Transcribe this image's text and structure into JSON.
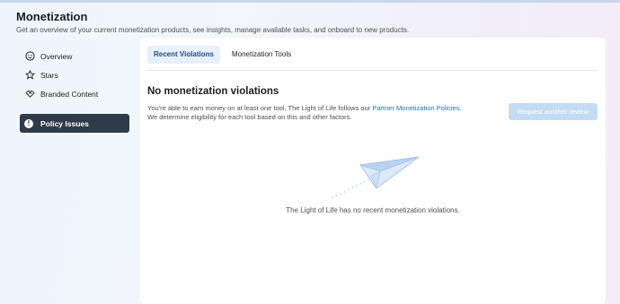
{
  "header": {
    "title": "Monetization",
    "subtitle": "Get an overview of your current monetization products, see insights, manage available tasks, and onboard to new products."
  },
  "sidebar": {
    "items": [
      {
        "label": "Overview",
        "icon": "smiley-icon"
      },
      {
        "label": "Stars",
        "icon": "star-icon"
      },
      {
        "label": "Branded Content",
        "icon": "handshake-icon"
      },
      {
        "label": "Policy Issues",
        "icon": "alert-icon",
        "active": true
      }
    ]
  },
  "tabs": [
    {
      "label": "Recent Violations",
      "active": true
    },
    {
      "label": "Monetization Tools",
      "active": false
    }
  ],
  "violations": {
    "title": "No monetization violations",
    "desc_before": "You're able to earn money on at least one tool. The Light of Life follows our ",
    "desc_link": "Partner Monetization Policies",
    "desc_after": ". We determine eligibility for each tool based on this and other factors.",
    "button_label": "Request another review",
    "empty_message": "The Light of Life has no recent monetization violations."
  },
  "colors": {
    "accent": "#1e73be",
    "active_nav_bg": "#2f3b48",
    "tab_active_bg": "#e7f0fb",
    "button_disabled_bg": "#c4dcf3"
  }
}
